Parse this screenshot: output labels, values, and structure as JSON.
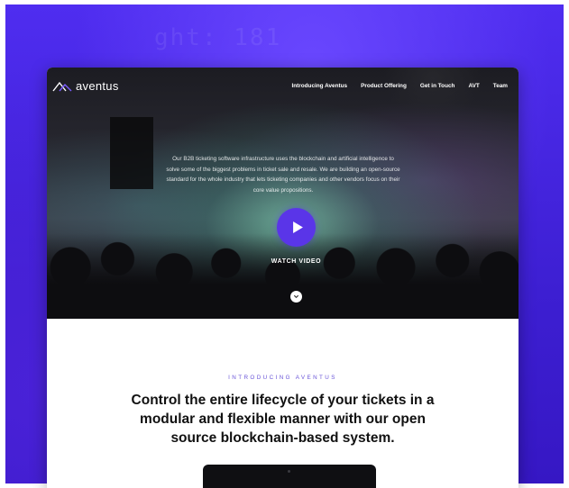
{
  "background": {
    "accent": "#4f2df0",
    "code_snippet": "ght: 181"
  },
  "brand": {
    "name": "aventus",
    "logo_icon": "aventus-logo-icon"
  },
  "nav": {
    "links": [
      {
        "label": "Introducing Aventus"
      },
      {
        "label": "Product Offering"
      },
      {
        "label": "Get in Touch"
      },
      {
        "label": "AVT"
      },
      {
        "label": "Team"
      }
    ]
  },
  "hero": {
    "description": "Our B2B ticketing software infrastructure uses the blockchain and artificial intelligence to solve some of the biggest problems in ticket sale and resale. We are building an open-source standard for the whole industry that lets ticketing companies and other vendors focus on their core value propositions.",
    "play_icon": "play-icon",
    "watch_label": "WATCH VIDEO",
    "scroll_icon": "chevron-down-icon",
    "play_color": "#5a35e8"
  },
  "intro": {
    "eyebrow": "INTRODUCING AVENTUS",
    "headline": "Control the entire lifecycle of your tickets in a modular and flexible manner with our open source blockchain-based system."
  }
}
